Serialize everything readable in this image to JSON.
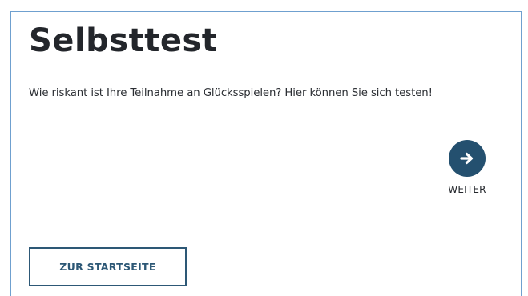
{
  "page": {
    "title": "Selbsttest",
    "intro": "Wie riskant ist Ihre Teilnahme an Glücksspielen? Hier können Sie sich testen!"
  },
  "next_button": {
    "label": "WEITER",
    "icon": "arrow-right-icon",
    "color": "#24506f"
  },
  "home_button": {
    "label": "ZUR STARTSEITE",
    "color": "#2d5876"
  },
  "colors": {
    "frame_border": "#6fa0cf",
    "text": "#23262b"
  }
}
